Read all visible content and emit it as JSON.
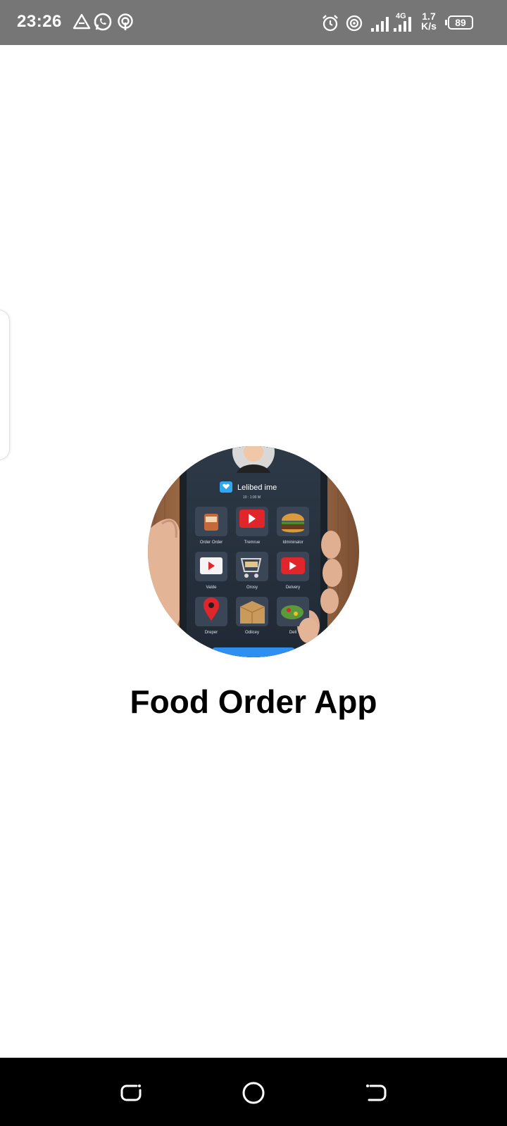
{
  "status_bar": {
    "time": "23:26",
    "left_icons": [
      "drive-icon",
      "whatsapp-icon",
      "hotspot-icon"
    ],
    "right_icons": [
      "alarm-icon",
      "hotspot-icon",
      "signal-icon",
      "signal-4g-icon"
    ],
    "network_type": "4G",
    "speed_value": "1.7",
    "speed_unit": "K/s",
    "battery": "89"
  },
  "hero_image": {
    "icon": "food-app-phone-illustration",
    "phone_header": "Lelibed ime",
    "phone_subheader": "10 : 1:00 M",
    "tiles": [
      {
        "label": "Order Order",
        "icon": "drink-icon"
      },
      {
        "label": "Tremrue",
        "icon": "play-icon"
      },
      {
        "label": "Idmininalor",
        "icon": "burger-icon"
      },
      {
        "label": "Valde",
        "icon": "video-icon"
      },
      {
        "label": "Orosy",
        "icon": "cart-icon"
      },
      {
        "label": "Delvery",
        "icon": "play-icon"
      },
      {
        "label": "Dreper",
        "icon": "location-pin-icon"
      },
      {
        "label": "Odiicey",
        "icon": "box-icon"
      },
      {
        "label": "Deli",
        "icon": "salad-icon"
      }
    ]
  },
  "app_title": "Food Order App",
  "nav_bar": {
    "buttons": [
      "recents-icon",
      "home-icon",
      "back-icon"
    ]
  },
  "colors": {
    "status_bar": "#767676",
    "background": "#ffffff",
    "nav_bar": "#000000",
    "title": "#000000"
  }
}
